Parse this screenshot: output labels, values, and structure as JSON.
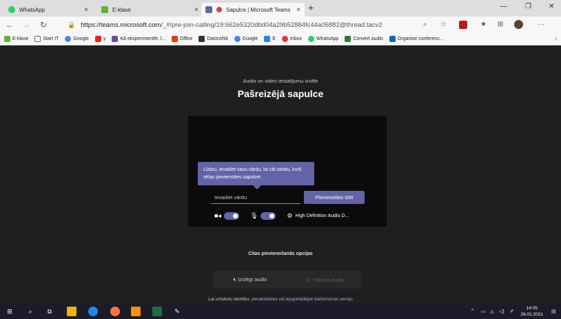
{
  "browser": {
    "tabs": [
      {
        "label": "WhatsApp",
        "icon": "whatsapp-icon",
        "color": "#25d366"
      },
      {
        "label": "E-klase",
        "icon": "eklase-icon",
        "color": "#5fb336"
      },
      {
        "label": "Sapulce | Microsoft Teams",
        "icon": "teams-icon",
        "color": "#6264a7"
      }
    ],
    "new_tab": "+",
    "url_host": "https://teams.microsoft.com",
    "url_path": "/_#/pre-join-calling/19:662e5320dbd04a29b52884fc44a05882@thread.tacv2",
    "bookmarks": [
      {
        "label": "E-klase",
        "color": "#5fb336"
      },
      {
        "label": "Start IT",
        "color": "#f7f7f7"
      },
      {
        "label": "Google",
        "color": "#4285f4"
      },
      {
        "label": "y",
        "color": "#e62117"
      },
      {
        "label": "Kā eksperimentēt, l...",
        "color": "#6a4c93"
      },
      {
        "label": "Office",
        "color": "#eb3c00"
      },
      {
        "label": "Datorzētā",
        "color": "#333333"
      },
      {
        "label": "Google",
        "color": "#4285f4"
      },
      {
        "label": "E",
        "color": "#1e88e5"
      },
      {
        "label": "Inbox",
        "color": "#e53935"
      },
      {
        "label": "WhatsApp",
        "color": "#25d366"
      },
      {
        "label": "Convert audio",
        "color": "#2e7d32"
      },
      {
        "label": "Organise conferenc...",
        "color": "#1565c0"
      }
    ]
  },
  "prejoin": {
    "subtitle": "Audio un video iestatījumu izvēle",
    "title": "Pašreizējā sapulce",
    "tooltip": "Lūdzu, ievadiet savu vārdu, lai citi zinātu, kurš vēlas pievienoties sapulcei.",
    "name_placeholder": "Ievadiet vārdu",
    "join_label": "Pievienoties tūlīt",
    "device_label": "High Definition Audio D...",
    "other_title": "Citas pievienošanās opcijas",
    "audio_off_label": "Izslēgt audio",
    "phone_audio_label": "Tālruņa audio",
    "footer_prefix": "Lai uzlabotu darbību, ",
    "footer_link": "pierakstieties vai lejupielādējiet darbvirsmas versiju"
  },
  "taskbar": {
    "time": "14:05",
    "date": "26.01.2021"
  },
  "colors": {
    "accent": "#6264a7",
    "background": "#201f1f"
  }
}
